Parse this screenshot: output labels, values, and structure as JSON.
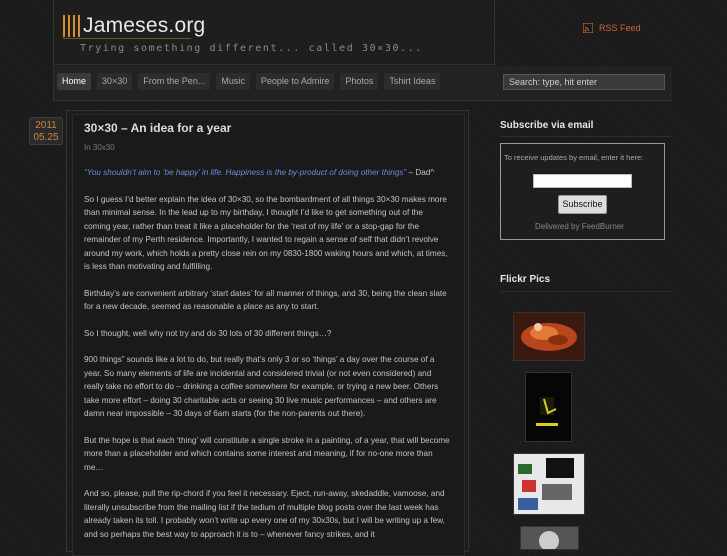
{
  "site": {
    "title": "Jameses.org",
    "tagline": "Trying something different... called 30×30...",
    "rss_label": "RSS Feed"
  },
  "nav": {
    "items": [
      "Home",
      "30×30",
      "From the Pen...",
      "Music",
      "People to Admire",
      "Photos",
      "Tshirt Ideas"
    ],
    "active": "Home"
  },
  "search": {
    "placeholder": "Search: type, hit enter"
  },
  "post": {
    "date_year": "2011",
    "date_day": "05.25",
    "title": "30×30 – An idea for a year",
    "category": "In 30x30",
    "quote": "“You shouldn’t aim to ‘be happy’ in life. Happiness is the by-product of doing other things”",
    "quote_attribution": " – Dad^",
    "paragraphs": [
      "So I guess I’d better explain the idea of 30×30, so the bombardment of all things 30×30 makes more than minimal sense. In the lead up to my birthday, I thought I’d like to get something out of the coming year, rather than treat it like a placeholder for the ‘rest of my life’ or a stop-gap for the remainder of my Perth residence. Importantly, I wanted to regain a sense of self that didn’t revolve around my work, which holds a pretty close rein on my 0830-1800 waking hours and which, at times, is less than motivating and fulfilling.",
      "Birthday’s are convenient arbitrary ‘start dates’ for all manner of things, and 30, being the clean slate for a new decade, seemed as reasonable a place as any to start.",
      "So I thought, well why not try and do 30 lots of 30 different things…?",
      "900 things” sounds like a lot to do, but really that’s only 3 or so ‘things’ a day over the course of a year. So many elements of life are incidental and considered trivial (or not even considered) and really take no effort to do – drinking a coffee somewhere for example, or trying a new beer. Others take more effort – doing 30 charitable acts or seeing 30 live music performances – and others are damn near impossible – 30 days of 6am starts (for the non-parents out there).",
      "But the hope is that each ‘thing’ will constitute a single stroke in a painting, of a year, that will become more than a placeholder and which contains some interest and meaning, if for no-one more than me…",
      "And so, please, pull the rip-chord if you feel it necessary. Eject, run-away, skedaddle, vamoose, and literally unsubscribe from the mailing list if the tedium of multiple blog posts over the last week has already taken its toll. I probably won’t write up every one of my 30x30s, but I will be writing up a few, and so perhaps the best way to approach it is to – whenever fancy strikes, and it"
    ]
  },
  "sidebar": {
    "subscribe_title": "Subscribe via email",
    "subscribe_text": "To receive updates by email, enter it here:",
    "subscribe_button": "Subscribe",
    "delivered_by": "Delivered by FeedBurner",
    "flickr_title": "Flickr Pics"
  },
  "colors": {
    "accent": "#d48d2f",
    "link": "#6b8fd6",
    "rss": "#cc6633"
  }
}
